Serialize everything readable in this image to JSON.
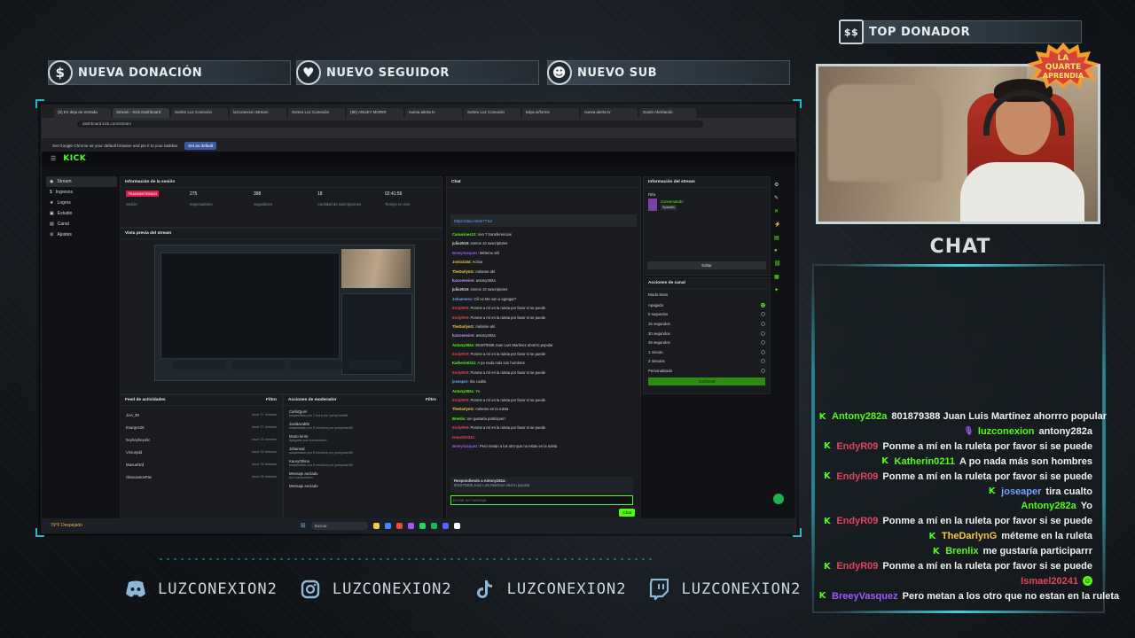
{
  "alerts": {
    "donation": "NUEVA DONACIÓN",
    "follower": "NUEVO SEGUIDOR",
    "sub": "NUEVO SUB",
    "top_donor": "TOP DONADOR"
  },
  "browser": {
    "tabs": [
      "(5) En deja de entrada",
      "Stream - Kick Dashboard",
      "Sorteo Luz Conexión",
      "luzconexion Stream",
      "Sorteo Luz Conexión",
      "(80) ANUEY MORIR",
      "nueva alerta tv",
      "Sorteo Luz Conexión",
      "talya.io/forms",
      "nueva alerta tv",
      "Gustó Abrirlando"
    ],
    "url": "dashboard.kick.com/stream",
    "default_banner": "Set Google Chrome as your default browser and pin it to your taskbar",
    "set_default": "Set as default"
  },
  "kick": {
    "logo": "KICK",
    "nav": [
      "Stream",
      "Ingresos",
      "Logros",
      "Estudio",
      "Canal",
      "Ajustes"
    ],
    "session_title": "Información de la sesión",
    "stats": [
      {
        "value": "TRANSMITIENDO",
        "label": "Sesión"
      },
      {
        "value": "275",
        "label": "Espectadores"
      },
      {
        "value": "398",
        "label": "Seguidores"
      },
      {
        "value": "18",
        "label": "Cantidad de suscripciones"
      },
      {
        "value": "02:41:56",
        "label": "Tiempo en vivo"
      }
    ],
    "preview_title": "Vista previa del stream",
    "feed_title": "Feed de actividades",
    "feed_filter": "Filtro",
    "feed_items": [
      {
        "user": "Jovi_39",
        "time": "hace 27 minutos"
      },
      {
        "user": "Evarges26",
        "time": "hace 27 minutos"
      },
      {
        "user": "heyheyheyolic",
        "time": "hace 33 minutos"
      },
      {
        "user": "Virsurydd",
        "time": "hace 23 minutos"
      },
      {
        "user": "Manuel3rd",
        "time": "hace 23 minutos"
      },
      {
        "user": "OlancantosPav",
        "time": "hace 26 minutos"
      }
    ],
    "mod_title": "Acciones de moderador",
    "mod_items": [
      {
        "user": "CarlsQjuni",
        "action": "suspendido por 1 hora por yorkyman88"
      },
      {
        "user": "Joeldavid05",
        "action": "suspendido por 5 minutos por yorkyman88"
      },
      {
        "user": "Modo lento",
        "action": "apagado por luzconexion"
      },
      {
        "user": "Johaneal",
        "action": "suspendido por 5 minutos por yorkyman88"
      },
      {
        "user": "Kaury0thina",
        "action": "suspendido por 5 minutos por yorkyman88"
      },
      {
        "user": "Mensaje anclado",
        "action": "por luzconexion"
      },
      {
        "user": "Mensaje anclado",
        "action": ""
      }
    ],
    "chat_title": "Chat",
    "chat_pinned_link": "https://taly.esh/e77SZ",
    "chat_lines": [
      {
        "user": "Camarines12:",
        "text": "Veo 7 transferencias",
        "color": "#53fc18"
      },
      {
        "user": "julio2019:",
        "text": "somos 10 suscriptores",
        "color": "#d6d8db"
      },
      {
        "user": "BreeyVasquez:",
        "text": "Méteme ahí",
        "color": "#9b5cf6"
      },
      {
        "user": "Jovio2104:",
        "text": "Activa",
        "color": "#f5c84c"
      },
      {
        "user": "TheDarlynG:",
        "text": "métame ahí",
        "color": "#f5c84c"
      },
      {
        "user": "luzconexion:",
        "text": "antony282a",
        "color": "#c79cf7"
      },
      {
        "user": "julio2019:",
        "text": "somos 10 suscriptores",
        "color": "#d6d8db"
      },
      {
        "user": "Johannesx:",
        "text": "Oíí no Me van a agregar?",
        "color": "#7aa2ff"
      },
      {
        "user": "EndyR09:",
        "text": "Ponme a mí en la ruleta por favor si se puede",
        "color": "#e0445f"
      },
      {
        "user": "EndyR09:",
        "text": "Ponme a mí en la ruleta por favor si se puede",
        "color": "#e0445f"
      },
      {
        "user": "TheDarlynG:",
        "text": "métame ahí",
        "color": "#f5c84c"
      },
      {
        "user": "luzconexion:",
        "text": "antony282a",
        "color": "#c79cf7"
      },
      {
        "user": "Antony282a:",
        "text": "801879388 Juan Luis Martínez ahorrro popular",
        "color": "#53fc18"
      },
      {
        "user": "EndyR09:",
        "text": "Ponme a mí en la ruleta por favor si se puede",
        "color": "#e0445f"
      },
      {
        "user": "Katherin0211:",
        "text": "A po nada más son hombres",
        "color": "#53fc18"
      },
      {
        "user": "EndyR09:",
        "text": "Ponme a mí en la ruleta por favor si se puede",
        "color": "#e0445f"
      },
      {
        "user": "joseaper:",
        "text": "tira cualto",
        "color": "#7aa2ff"
      },
      {
        "user": "Antony282a:",
        "text": "Yo",
        "color": "#53fc18"
      },
      {
        "user": "EndyR09:",
        "text": "Ponme a mí en la ruleta por favor si se puede",
        "color": "#e0445f"
      },
      {
        "user": "TheDarlynG:",
        "text": "méteme en la ruleta",
        "color": "#f5c84c"
      },
      {
        "user": "Brenlix:",
        "text": "me gustaría participarrr",
        "color": "#53fc18"
      },
      {
        "user": "EndyR09:",
        "text": "Ponme a mí en la ruleta por favor si se puede",
        "color": "#e0445f"
      },
      {
        "user": "Ismael20241:",
        "text": "",
        "color": "#e0445f"
      },
      {
        "user": "BreeyVasquez:",
        "text": "Pero metan a los otro que no estan en la ruleta",
        "color": "#9b5cf6"
      }
    ],
    "reply_label": "Respondiendo a Antony282a:",
    "reply_text": "801879388 Juan Luis Martinez ahorro popular",
    "chat_placeholder": "Enviar un mensaje",
    "chat_button": "Chat",
    "stream_info_title": "Información del stream",
    "stream_info_category": "Rifa",
    "stream_info_sub": "Conversando",
    "stream_info_tag": "Spanish",
    "edit_button": "Editar",
    "channel_actions_title": "Acciones de canal",
    "slow_mode": "Modo lento",
    "slow_options": [
      "Apagado",
      "5 segundos",
      "15 segundos",
      "30 segundos",
      "45 segundos",
      "1 minuto",
      "2 minutos",
      "Personalizado"
    ],
    "slow_selected_index": 0,
    "confirm_button": "Confirmar",
    "taskbar_search": "Buscar",
    "weather": "79°F Despejado"
  },
  "overlay": {
    "logo_text": "LA QUARTE APRENDIA",
    "chat_title": "CHAT",
    "messages": [
      {
        "badge": "kick",
        "user": "Antony282a",
        "text": "801879388 Juan Luis Martínez ahorrro popular",
        "color": "#53fc18"
      },
      {
        "badge": "mic",
        "user": "luzconexion",
        "text": "antony282a",
        "color": "#53fc18"
      },
      {
        "badge": "kick",
        "user": "EndyR09",
        "text": "Ponme a mí en la ruleta por favor si se puede",
        "color": "#e0445f"
      },
      {
        "badge": "kick",
        "user": "Katherin0211",
        "text": "A po nada más son hombres",
        "color": "#53fc18"
      },
      {
        "badge": "kick",
        "user": "EndyR09",
        "text": "Ponme a mí en la ruleta por favor si se puede",
        "color": "#e0445f"
      },
      {
        "badge": "kick",
        "user": "joseaper",
        "text": "tira cualto",
        "color": "#7aa2ff"
      },
      {
        "badge": "",
        "user": "Antony282a",
        "text": "Yo",
        "color": "#53fc18"
      },
      {
        "badge": "kick",
        "user": "EndyR09",
        "text": "Ponme a mí en la ruleta por favor si se puede",
        "color": "#e0445f"
      },
      {
        "badge": "kick",
        "user": "TheDarlynG",
        "text": "méteme en la ruleta",
        "color": "#f5c84c"
      },
      {
        "badge": "kick",
        "user": "Brenlix",
        "text": "me gustaría participarrr",
        "color": "#53fc18"
      },
      {
        "badge": "kick",
        "user": "EndyR09",
        "text": "Ponme a mí en la ruleta por favor si se puede",
        "color": "#e0445f"
      },
      {
        "badge": "",
        "user": "Ismael20241",
        "text": "",
        "color": "#e0445f",
        "emote": true
      },
      {
        "badge": "kick",
        "user": "BreeyVasquez",
        "text": "Pero metan a los otro que no estan en la ruleta",
        "color": "#9b5cf6"
      }
    ]
  },
  "socials": [
    {
      "icon": "discord-icon",
      "handle": "LUZCONEXION2"
    },
    {
      "icon": "instagram-icon",
      "handle": "LUZCONEXION2"
    },
    {
      "icon": "tiktok-icon",
      "handle": "LUZCONEXION2"
    },
    {
      "icon": "twitch-icon",
      "handle": "LUZCONEXION2"
    }
  ],
  "colors": {
    "kick_green": "#53fc18",
    "accent_cyan": "#2ab6c9"
  }
}
